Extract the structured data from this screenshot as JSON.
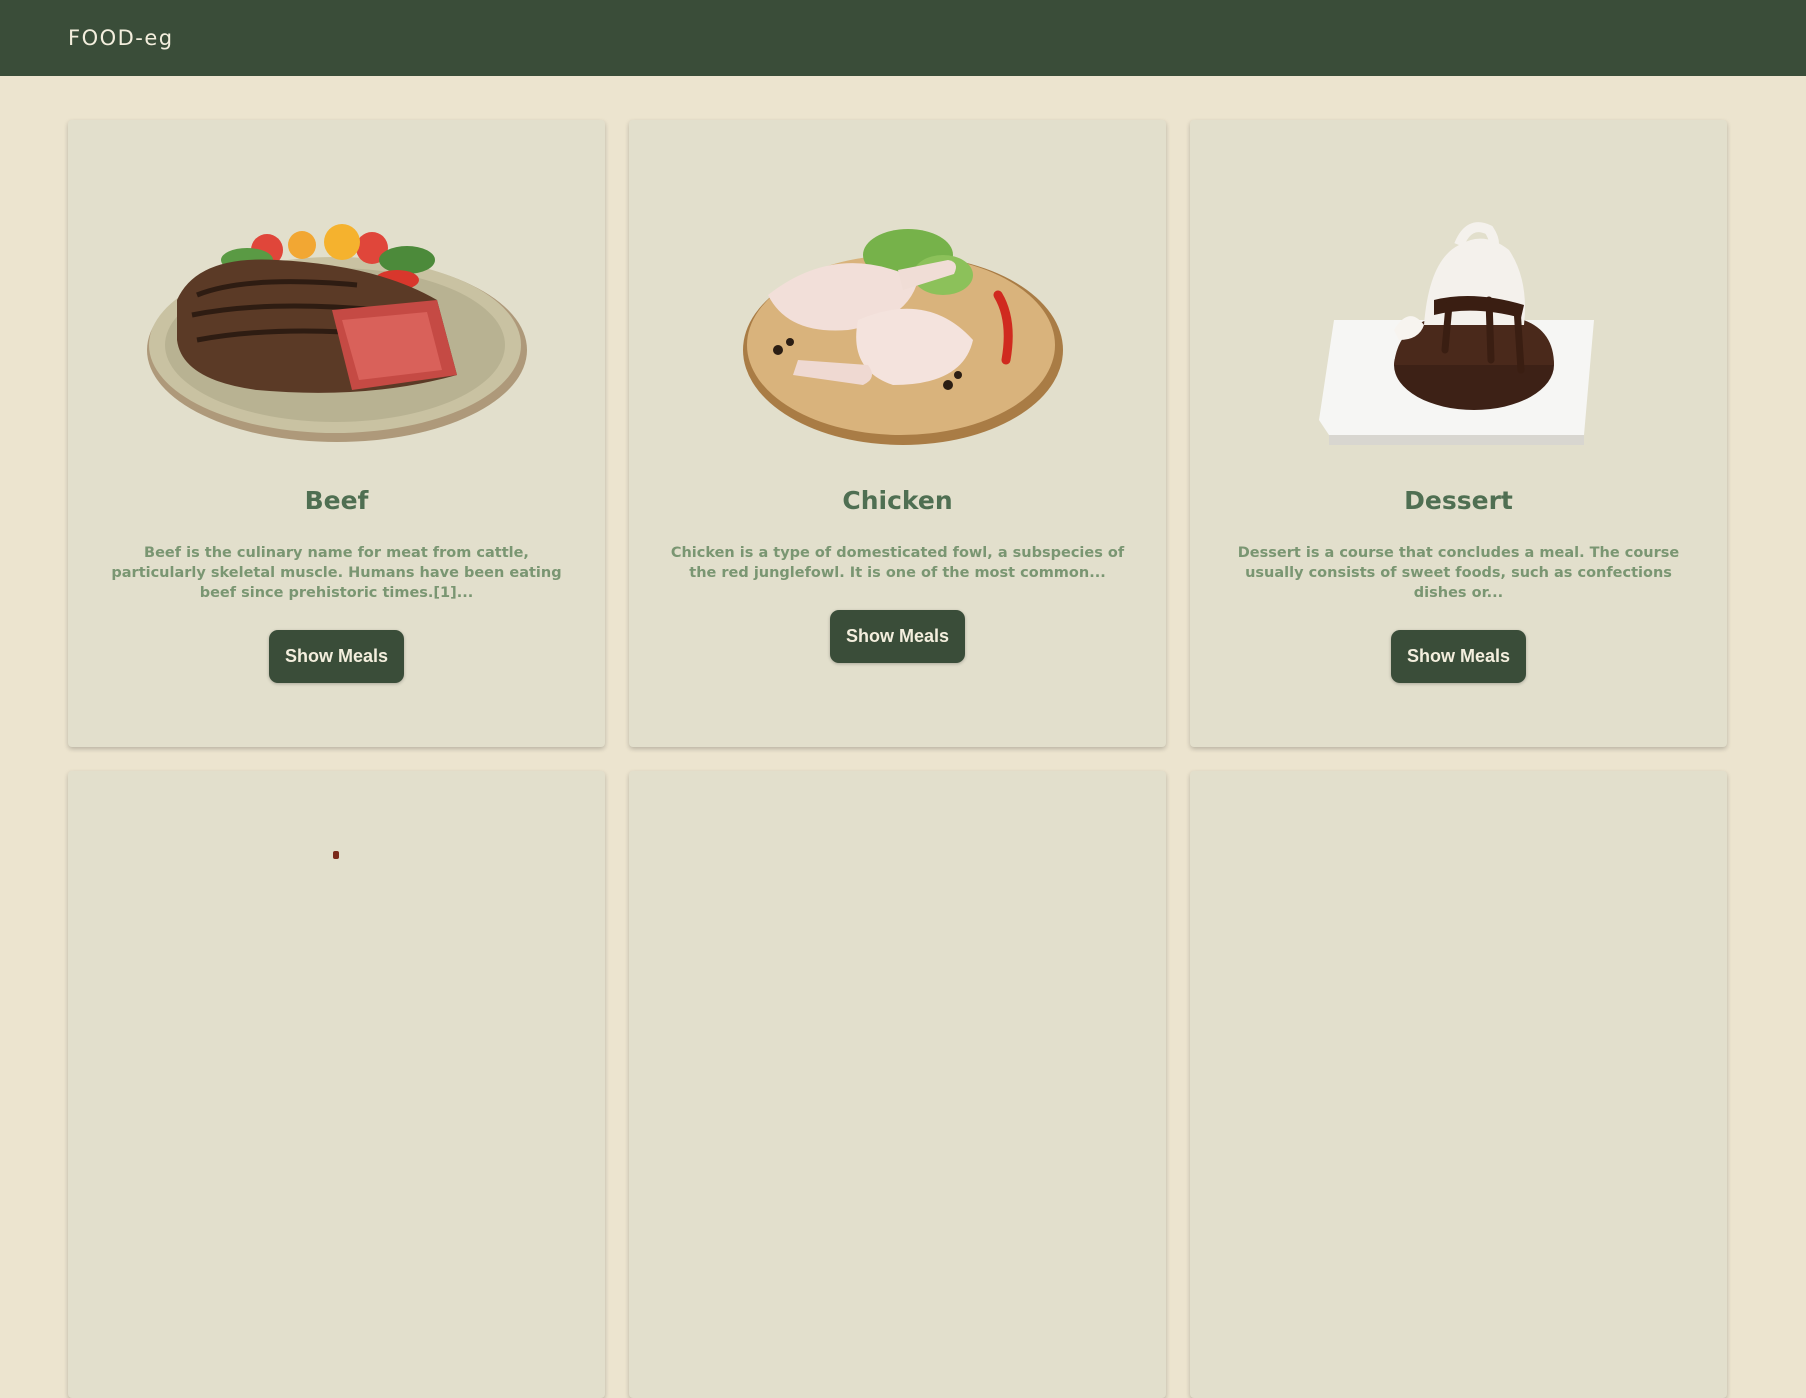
{
  "navbar": {
    "brand": "FOOD-eg"
  },
  "categories": [
    {
      "name": "Beef",
      "description": "Beef is the culinary name for meat from cattle, particularly skeletal muscle. Humans have been eating beef since prehistoric times.[1]...",
      "button": "Show Meals",
      "image": "steak-plate-image"
    },
    {
      "name": "Chicken",
      "description": "Chicken is a type of domesticated fowl, a subspecies of the red junglefowl. It is one of the most common...",
      "button": "Show Meals",
      "image": "chicken-legs-board-image"
    },
    {
      "name": "Dessert",
      "description": "Dessert is a course that concludes a meal. The course usually consists of sweet foods, such as confections dishes or...",
      "button": "Show Meals",
      "image": "chocolate-lava-cake-image"
    }
  ],
  "colors": {
    "navbar": "#3a4d39",
    "background": "#ece4cf",
    "card": "#e2dfcc",
    "title": "#4f6f52",
    "description": "#7a9672",
    "button": "#3a4d39"
  }
}
